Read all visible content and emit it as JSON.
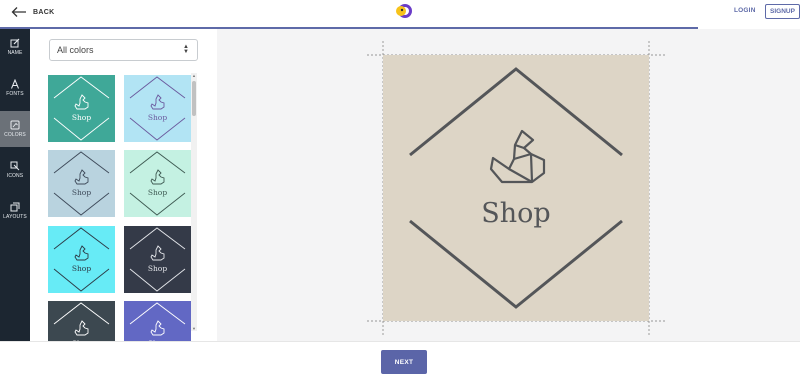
{
  "header": {
    "back_label": "BACK",
    "login_label": "LOGIN",
    "signup_label": "SIGNUP",
    "accent_color": "#5e6aa8"
  },
  "nav": {
    "items": [
      {
        "label": "NAME",
        "icon": "edit-icon"
      },
      {
        "label": "FONTS",
        "icon": "font-icon"
      },
      {
        "label": "COLORS",
        "icon": "palette-icon",
        "active": true
      },
      {
        "label": "ICONS",
        "icon": "icon-shapes-icon"
      },
      {
        "label": "LAYOUTS",
        "icon": "layouts-icon"
      }
    ]
  },
  "colors_panel": {
    "filter_value": "All colors",
    "thumbnail_text": "Shop",
    "swatches": [
      {
        "bg": "#3fa898",
        "fg": "#ffffff"
      },
      {
        "bg": "#b2e4f4",
        "fg": "#6b5a9e"
      },
      {
        "bg": "#b9d3df",
        "fg": "#3e4a5a"
      },
      {
        "bg": "#c4f1e2",
        "fg": "#3e5a52"
      },
      {
        "bg": "#67ebf6",
        "fg": "#2c3a46"
      },
      {
        "bg": "#343a48",
        "fg": "#e4e6ea"
      },
      {
        "bg": "#3c4850",
        "fg": "#ffffff"
      },
      {
        "bg": "#6268c4",
        "fg": "#ffffff"
      }
    ]
  },
  "preview": {
    "text": "Shop",
    "bg": "#ddd5c6",
    "fg": "#545659"
  },
  "footer": {
    "next_label": "NEXT"
  }
}
